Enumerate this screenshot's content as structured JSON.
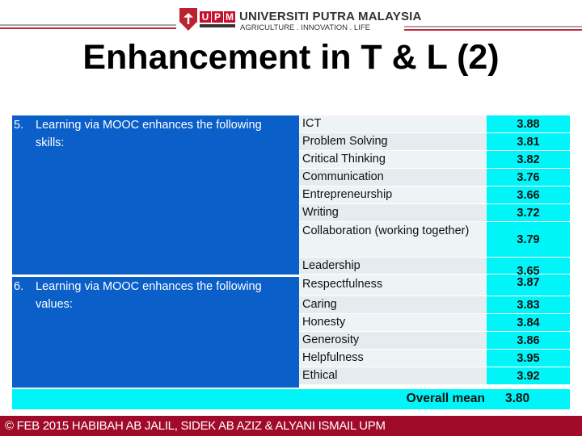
{
  "header": {
    "logo_letters": [
      "U",
      "P",
      "M"
    ],
    "university_name": "UNIVERSITI PUTRA MALAYSIA",
    "tagline": "AGRICULTURE . INNOVATION . LIFE",
    "line_colors": {
      "gray": "#a6a6a6",
      "red": "#c0293a"
    }
  },
  "title": "Enhancement in T & L (2)",
  "sections": [
    {
      "number": "5.",
      "text": "Learning via MOOC enhances the following skills:",
      "items": [
        {
          "label": "ICT",
          "value": "3.88"
        },
        {
          "label": "Problem Solving",
          "value": "3.81"
        },
        {
          "label": "Critical Thinking",
          "value": "3.82"
        },
        {
          "label": "Communication",
          "value": "3.76"
        },
        {
          "label": "Entrepreneurship",
          "value": "3.66"
        },
        {
          "label": "Writing",
          "value": "3.72"
        },
        {
          "label": "Collaboration (working together)",
          "value": "3.79"
        },
        {
          "label": "Leadership",
          "value": "3.65"
        }
      ]
    },
    {
      "number": "6.",
      "text": "Learning via MOOC enhances the following values:",
      "items": [
        {
          "label": "Respectfulness",
          "value": "3.87"
        },
        {
          "label": "Caring",
          "value": "3.83"
        },
        {
          "label": "Honesty",
          "value": "3.84"
        },
        {
          "label": "Generosity",
          "value": "3.86"
        },
        {
          "label": "Helpfulness",
          "value": "3.95"
        },
        {
          "label": "Ethical",
          "value": "3.92"
        }
      ]
    }
  ],
  "overall": {
    "label": "Overall mean",
    "value": "3.80"
  },
  "footer": {
    "text": "© FEB 2015 HABIBAH AB JALIL, SIDEK AB AZIZ & ALYANI ISMAIL UPM"
  },
  "colors": {
    "section_bg": "#0a5fc9",
    "value_bg": "#00f5f8",
    "footer_bg": "#a00b2a"
  }
}
